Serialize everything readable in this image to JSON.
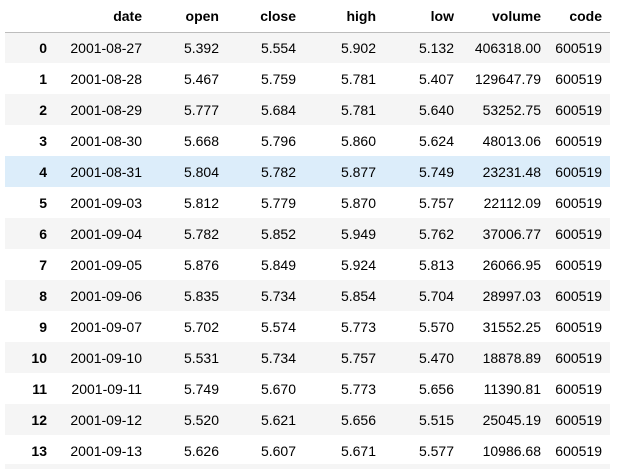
{
  "table": {
    "columns": [
      "",
      "date",
      "open",
      "close",
      "high",
      "low",
      "volume",
      "code"
    ],
    "highlighted_row": 4,
    "rows": [
      {
        "index": "0",
        "cells": [
          "2001-08-27",
          "5.392",
          "5.554",
          "5.902",
          "5.132",
          "406318.00",
          "600519"
        ]
      },
      {
        "index": "1",
        "cells": [
          "2001-08-28",
          "5.467",
          "5.759",
          "5.781",
          "5.407",
          "129647.79",
          "600519"
        ]
      },
      {
        "index": "2",
        "cells": [
          "2001-08-29",
          "5.777",
          "5.684",
          "5.781",
          "5.640",
          "53252.75",
          "600519"
        ]
      },
      {
        "index": "3",
        "cells": [
          "2001-08-30",
          "5.668",
          "5.796",
          "5.860",
          "5.624",
          "48013.06",
          "600519"
        ]
      },
      {
        "index": "4",
        "cells": [
          "2001-08-31",
          "5.804",
          "5.782",
          "5.877",
          "5.749",
          "23231.48",
          "600519"
        ]
      },
      {
        "index": "5",
        "cells": [
          "2001-09-03",
          "5.812",
          "5.779",
          "5.870",
          "5.757",
          "22112.09",
          "600519"
        ]
      },
      {
        "index": "6",
        "cells": [
          "2001-09-04",
          "5.782",
          "5.852",
          "5.949",
          "5.762",
          "37006.77",
          "600519"
        ]
      },
      {
        "index": "7",
        "cells": [
          "2001-09-05",
          "5.876",
          "5.849",
          "5.924",
          "5.813",
          "26066.95",
          "600519"
        ]
      },
      {
        "index": "8",
        "cells": [
          "2001-09-06",
          "5.835",
          "5.734",
          "5.854",
          "5.704",
          "28997.03",
          "600519"
        ]
      },
      {
        "index": "9",
        "cells": [
          "2001-09-07",
          "5.702",
          "5.574",
          "5.773",
          "5.570",
          "31552.25",
          "600519"
        ]
      },
      {
        "index": "10",
        "cells": [
          "2001-09-10",
          "5.531",
          "5.734",
          "5.757",
          "5.470",
          "18878.89",
          "600519"
        ]
      },
      {
        "index": "11",
        "cells": [
          "2001-09-11",
          "5.749",
          "5.670",
          "5.773",
          "5.656",
          "11390.81",
          "600519"
        ]
      },
      {
        "index": "12",
        "cells": [
          "2001-09-12",
          "5.520",
          "5.621",
          "5.656",
          "5.515",
          "25045.19",
          "600519"
        ]
      },
      {
        "index": "13",
        "cells": [
          "2001-09-13",
          "5.626",
          "5.607",
          "5.671",
          "5.577",
          "10986.68",
          "600519"
        ]
      }
    ]
  }
}
